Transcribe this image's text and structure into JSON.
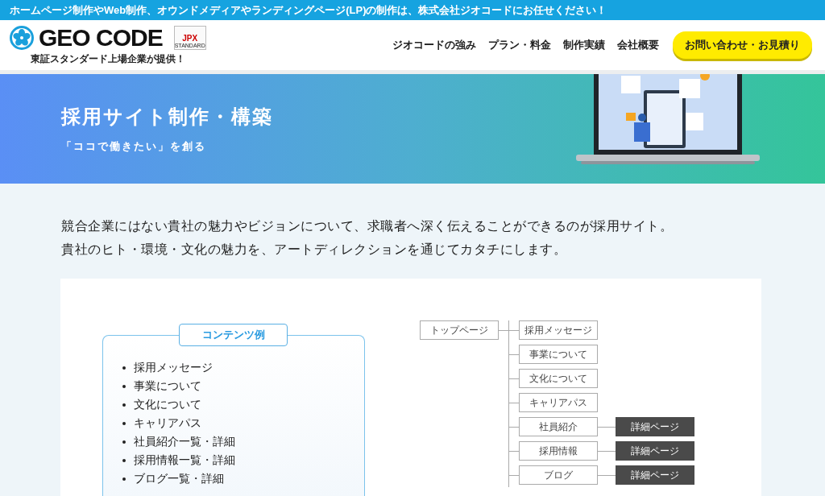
{
  "top_banner": {
    "text": "ホームページ制作やWeb制作、オウンドメディアやランディングページ(LP)の制作は、株式会社ジオコードにお任せください！"
  },
  "header": {
    "logo_text": "GEO CODE",
    "badge_text": "JPX",
    "badge_subtext": "STANDARD",
    "tagline": "東証スタンダード上場企業が提供！",
    "nav": [
      "ジオコードの強み",
      "プラン・料金",
      "制作実績",
      "会社概要"
    ],
    "cta": "お問い合わせ・お見積り"
  },
  "hero": {
    "title": "採用サイト制作・構築",
    "subtitle": "「ココで働きたい」を創る"
  },
  "intro": [
    "競合企業にはない貴社の魅力やビジョンについて、求職者へ深く伝えることができるのが採用サイト。",
    "貴社のヒト・環境・文化の魅力を、アートディレクションを通じてカタチにします。"
  ],
  "contents_box": {
    "title": "コンテンツ例",
    "items": [
      "採用メッセージ",
      "事業について",
      "文化について",
      "キャリアパス",
      "社員紹介一覧・詳細",
      "採用情報一覧・詳細",
      "ブログ一覧・詳細"
    ]
  },
  "sitemap": {
    "root": "トップページ",
    "pages": [
      {
        "label": "採用メッセージ"
      },
      {
        "label": "事業について"
      },
      {
        "label": "文化について"
      },
      {
        "label": "キャリアパス"
      },
      {
        "label": "社員紹介",
        "detail": "詳細ページ"
      },
      {
        "label": "採用情報",
        "detail": "詳細ページ"
      },
      {
        "label": "ブログ",
        "detail": "詳細ページ"
      }
    ]
  }
}
